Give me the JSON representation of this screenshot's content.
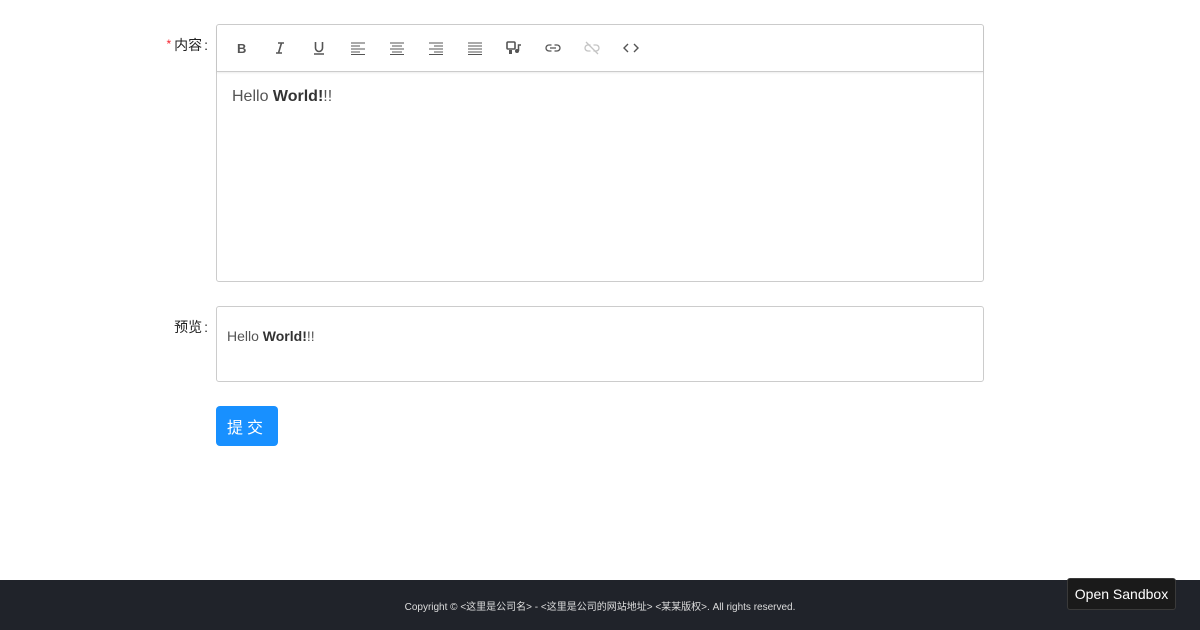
{
  "form": {
    "content_label": "内容",
    "content_required_mark": "*",
    "colon": ":",
    "preview_label": "预览",
    "submit_label": "提交"
  },
  "editor": {
    "toolbar": [
      {
        "name": "bold-icon",
        "title": "B",
        "disabled": false
      },
      {
        "name": "italic-icon",
        "title": "I",
        "disabled": false
      },
      {
        "name": "underline-icon",
        "title": "U",
        "disabled": false
      },
      {
        "name": "align-left-icon",
        "title": "",
        "disabled": false
      },
      {
        "name": "align-center-icon",
        "title": "",
        "disabled": false
      },
      {
        "name": "align-right-icon",
        "title": "",
        "disabled": false
      },
      {
        "name": "align-justify-icon",
        "title": "",
        "disabled": false
      },
      {
        "name": "media-icon",
        "title": "",
        "disabled": false
      },
      {
        "name": "link-icon",
        "title": "",
        "disabled": false
      },
      {
        "name": "unlink-icon",
        "title": "",
        "disabled": true
      },
      {
        "name": "code-icon",
        "title": "",
        "disabled": false
      }
    ],
    "content_plain_before": "Hello ",
    "content_bold": "World!",
    "content_plain_after": "!!"
  },
  "preview": {
    "plain_before": "Hello ",
    "bold": "World!",
    "plain_after": "!!"
  },
  "footer": {
    "text": "Copyright © <这里是公司名> - <这里是公司的网站地址> <某某版权>. All rights reserved."
  },
  "sandbox": {
    "label": "Open Sandbox"
  },
  "colors": {
    "primary": "#1890ff",
    "required": "#f5222d",
    "footer_bg": "#20232a"
  }
}
